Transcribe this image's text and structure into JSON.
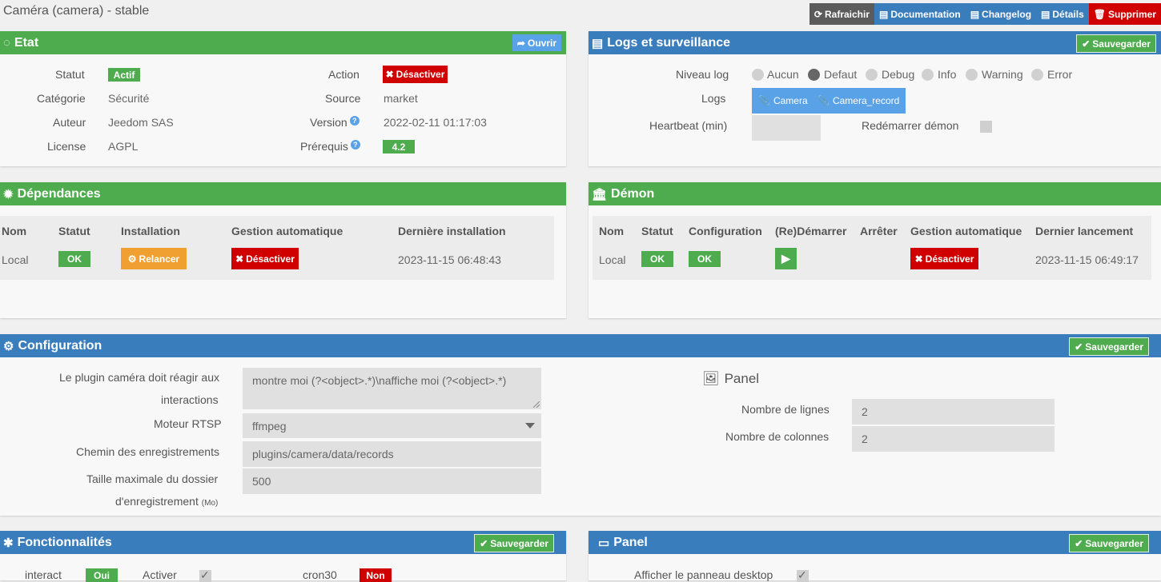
{
  "page": {
    "title": "Caméra (camera) - stable"
  },
  "toolbar": {
    "refresh": "Rafraichir",
    "documentation": "Documentation",
    "changelog": "Changelog",
    "details": "Détails",
    "delete": "Supprimer"
  },
  "etat": {
    "title": "Etat",
    "open_label": "Ouvrir",
    "statut_label": "Statut",
    "statut_value": "Actif",
    "categorie_label": "Catégorie",
    "categorie_value": "Sécurité",
    "auteur_label": "Auteur",
    "auteur_value": "Jeedom SAS",
    "license_label": "License",
    "license_value": "AGPL",
    "action_label": "Action",
    "action_value": "Désactiver",
    "source_label": "Source",
    "source_value": "market",
    "version_label": "Version",
    "version_value": "2022-02-11 01:17:03",
    "prerequis_label": "Prérequis",
    "prerequis_value": "4.2"
  },
  "logs": {
    "title": "Logs et surveillance",
    "save_label": "Sauvegarder",
    "niveau_label": "Niveau log",
    "levels": [
      "Aucun",
      "Defaut",
      "Debug",
      "Info",
      "Warning",
      "Error"
    ],
    "selected_level": "Defaut",
    "logs_label": "Logs",
    "log_files": [
      "Camera",
      "Camera_record"
    ],
    "heartbeat_label": "Heartbeat (min)",
    "heartbeat_value": "",
    "restart_label": "Redémarrer démon"
  },
  "deps": {
    "title": "Dépendances",
    "headers": [
      "Nom",
      "Statut",
      "Installation",
      "Gestion automatique",
      "Dernière installation"
    ],
    "row": {
      "nom": "Local",
      "statut": "OK",
      "installation": "Relancer",
      "gestion": "Désactiver",
      "derniere": "2023-11-15 06:48:43"
    }
  },
  "demon": {
    "title": "Démon",
    "headers": [
      "Nom",
      "Statut",
      "Configuration",
      "(Re)Démarrer",
      "Arrêter",
      "Gestion automatique",
      "Dernier lancement"
    ],
    "row": {
      "nom": "Local",
      "statut": "OK",
      "configuration": "OK",
      "gestion": "Désactiver",
      "dernier": "2023-11-15 06:49:17"
    }
  },
  "config": {
    "title": "Configuration",
    "save_label": "Sauvegarder",
    "interactions_label_1": "Le plugin caméra doit réagir aux",
    "interactions_label_2": "interactions",
    "interactions_value": "montre moi (?<object>.*)\\naffiche moi (?<object>.*)",
    "rtsp_label": "Moteur RTSP",
    "rtsp_value": "ffmpeg",
    "chemin_label": "Chemin des enregistrements",
    "chemin_value": "plugins/camera/data/records",
    "taille_label_1": "Taille maximale du dossier",
    "taille_label_2": "d'enregistrement",
    "taille_unit": "(Mo)",
    "taille_value": "500",
    "panel_title": "Panel",
    "lignes_label": "Nombre de lignes",
    "lignes_value": "2",
    "colonnes_label": "Nombre de colonnes",
    "colonnes_value": "2"
  },
  "fonct": {
    "title": "Fonctionnalités",
    "save_label": "Sauvegarder",
    "interact_label": "interact",
    "interact_value": "Oui",
    "activer_label": "Activer",
    "cron_label": "cron30",
    "cron_value": "Non"
  },
  "panel2": {
    "title": "Panel",
    "save_label": "Sauvegarder",
    "desktop_label": "Afficher le panneau desktop"
  }
}
